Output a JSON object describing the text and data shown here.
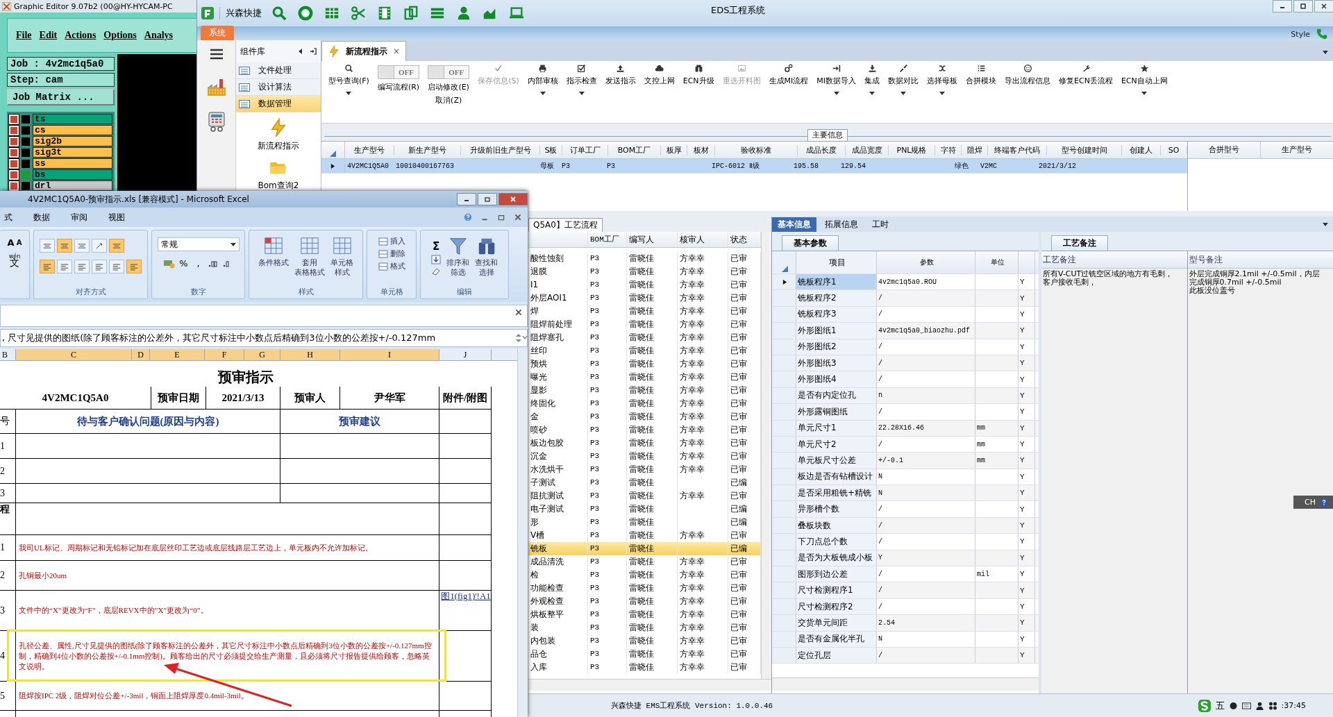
{
  "graphic_editor": {
    "title": "Graphic Editor 9.07b2 (00@HY-HYCAM-PC",
    "menu": [
      "File",
      "Edit",
      "Actions",
      "Options",
      "Analys"
    ],
    "job": "Job : 4v2mc1q5a0",
    "step": "Step: cam",
    "matrix_button": "Job Matrix ...",
    "layers": [
      {
        "name": "ts",
        "color": "#00a67a",
        "selected": false
      },
      {
        "name": "cs",
        "color": "#ffc04a",
        "selected": false
      },
      {
        "name": "sig2b",
        "color": "#ffc04a",
        "selected": false
      },
      {
        "name": "sig3t",
        "color": "#ffc04a",
        "selected": false
      },
      {
        "name": "ss",
        "color": "#ffc04a",
        "selected": false
      },
      {
        "name": "bs",
        "color": "#00a67a",
        "selected": true
      },
      {
        "name": "drl",
        "color": "#c8c8c8",
        "selected": false
      }
    ]
  },
  "eds": {
    "app_name": "兴森快捷",
    "title": "EDS工程系统",
    "style_label": "Style",
    "system_tab": "系统",
    "component_panel": {
      "title": "组件库",
      "items": [
        {
          "label": "文件处理",
          "selected": false
        },
        {
          "label": "设计算法",
          "selected": false
        },
        {
          "label": "数据管理",
          "selected": true
        }
      ],
      "tools": [
        "新流程指示",
        "Bom查询2"
      ]
    },
    "doc_tab": {
      "label": "新流程指示",
      "close": "×"
    },
    "ribbon": [
      {
        "kind": "button",
        "label": "型号查询(F)",
        "dropdown": true,
        "disabled": false
      },
      {
        "kind": "toggle",
        "switch": "OFF",
        "on": false,
        "label": "编写流程(R)"
      },
      {
        "kind": "toggle",
        "switch": "OFF",
        "on": false,
        "label": "启动修改(E)",
        "sublabel": "取消(Z)"
      },
      {
        "kind": "button",
        "label": "保存信息(S)",
        "dropdown": false,
        "disabled": true
      },
      {
        "kind": "button",
        "label": "内部审核",
        "dropdown": true,
        "disabled": false
      },
      {
        "kind": "button",
        "label": "指示检查",
        "dropdown": true,
        "disabled": false
      },
      {
        "kind": "button",
        "label": "发送指示",
        "dropdown": false,
        "disabled": false
      },
      {
        "kind": "button",
        "label": "文控上网",
        "dropdown": false,
        "disabled": false
      },
      {
        "kind": "button",
        "label": "ECN升级",
        "dropdown": false,
        "disabled": false
      },
      {
        "kind": "button",
        "label": "重选开料图",
        "dropdown": false,
        "disabled": true
      },
      {
        "kind": "button",
        "label": "生成MI流程",
        "dropdown": false,
        "disabled": false
      },
      {
        "kind": "button",
        "label": "MI数据导入",
        "dropdown": true,
        "disabled": false
      },
      {
        "kind": "button",
        "label": "集成",
        "dropdown": true,
        "disabled": false
      },
      {
        "kind": "button",
        "label": "数据对比",
        "dropdown": true,
        "disabled": false
      },
      {
        "kind": "button",
        "label": "选择母板",
        "dropdown": true,
        "disabled": false
      },
      {
        "kind": "button",
        "label": "合拼模块",
        "dropdown": false,
        "disabled": false
      },
      {
        "kind": "button",
        "label": "导出流程信息",
        "dropdown": false,
        "disabled": false
      },
      {
        "kind": "button",
        "label": "修复ECN丢流程",
        "dropdown": false,
        "disabled": false
      },
      {
        "kind": "button",
        "label": "ECN自动上网",
        "dropdown": true,
        "disabled": false
      }
    ],
    "section_label": "主要信息",
    "main_grid": {
      "columns": [
        "生产型号",
        "新生产型号",
        "升级前旧生产型号",
        "S板",
        "订单工厂",
        "BOM工厂",
        "板厚",
        "板材",
        "验收标准",
        "成品长度",
        "成品宽度",
        "PNL规格",
        "字符",
        "阻焊",
        "终端客户代码",
        "型号创建时间",
        "创建人",
        "SO"
      ],
      "rows": [
        {
          "selected": true,
          "cells": [
            "4V2MC1Q5A0",
            "10010400167763",
            null,
            "母板",
            "P3",
            "P3",
            null,
            null,
            "IPC-6012 Ⅱ级",
            "195.58",
            "129.54",
            null,
            null,
            "绿色",
            "V2MC",
            "2021/3/12",
            null,
            null
          ]
        }
      ]
    },
    "merge_grid": {
      "columns": [
        "合拼型号",
        "生产型号"
      ]
    },
    "process_table": {
      "tab": "Q5A0】工艺流程",
      "columns": [
        "BOM工厂",
        "编写人",
        "核审人",
        "状态"
      ],
      "rows": [
        {
          "step": "酸性蚀刻",
          "factory": "P3",
          "writer": "雷晓佳",
          "reviewer": "方幸幸",
          "status": "已审",
          "selected": false
        },
        {
          "step": "退膜",
          "factory": "P3",
          "writer": "雷晓佳",
          "reviewer": "方幸幸",
          "status": "已审",
          "selected": false
        },
        {
          "step": "I1",
          "factory": "P3",
          "writer": "雷晓佳",
          "reviewer": "方幸幸",
          "status": "已审",
          "selected": false
        },
        {
          "step": "外层AOI1",
          "factory": "P3",
          "writer": "雷晓佳",
          "reviewer": "方幸幸",
          "status": "已审",
          "selected": false
        },
        {
          "step": "焊",
          "factory": "P3",
          "writer": "雷晓佳",
          "reviewer": "方幸幸",
          "status": "已审",
          "selected": false
        },
        {
          "step": "阻焊前处理",
          "factory": "P3",
          "writer": "雷晓佳",
          "reviewer": "方幸幸",
          "status": "已审",
          "selected": false
        },
        {
          "step": "阻焊塞孔",
          "factory": "P3",
          "writer": "雷晓佳",
          "reviewer": "方幸幸",
          "status": "已审",
          "selected": false
        },
        {
          "step": "丝印",
          "factory": "P3",
          "writer": "雷晓佳",
          "reviewer": "方幸幸",
          "status": "已审",
          "selected": false
        },
        {
          "step": "预烘",
          "factory": "P3",
          "writer": "雷晓佳",
          "reviewer": "方幸幸",
          "status": "已审",
          "selected": false
        },
        {
          "step": "曝光",
          "factory": "P3",
          "writer": "雷晓佳",
          "reviewer": "方幸幸",
          "status": "已审",
          "selected": false
        },
        {
          "step": "显影",
          "factory": "P3",
          "writer": "雷晓佳",
          "reviewer": "方幸幸",
          "status": "已审",
          "selected": false
        },
        {
          "step": "终固化",
          "factory": "P3",
          "writer": "雷晓佳",
          "reviewer": "方幸幸",
          "status": "已审",
          "selected": false
        },
        {
          "step": "金",
          "factory": "P3",
          "writer": "雷晓佳",
          "reviewer": "方幸幸",
          "status": "已审",
          "selected": false
        },
        {
          "step": "喷砂",
          "factory": "P3",
          "writer": "雷晓佳",
          "reviewer": "方幸幸",
          "status": "已审",
          "selected": false
        },
        {
          "step": "板边包胶",
          "factory": "P3",
          "writer": "雷晓佳",
          "reviewer": "方幸幸",
          "status": "已审",
          "selected": false
        },
        {
          "step": "沉金",
          "factory": "P3",
          "writer": "雷晓佳",
          "reviewer": "方幸幸",
          "status": "已审",
          "selected": false
        },
        {
          "step": "水洗烘干",
          "factory": "P3",
          "writer": "雷晓佳",
          "reviewer": "方幸幸",
          "status": "已审",
          "selected": false
        },
        {
          "step": "子测试",
          "factory": "P3",
          "writer": "雷晓佳",
          "status": "已编",
          "selected": false
        },
        {
          "step": "阻抗测试",
          "factory": "P3",
          "writer": "雷晓佳",
          "reviewer": "方幸幸",
          "status": "已审",
          "selected": false
        },
        {
          "step": "电子测试",
          "factory": "P3",
          "writer": "雷晓佳",
          "status": "已编",
          "selected": false
        },
        {
          "step": "形",
          "factory": "P3",
          "writer": "雷晓佳",
          "status": "已编",
          "selected": false
        },
        {
          "step": "V槽",
          "factory": "P3",
          "writer": "雷晓佳",
          "reviewer": "方幸幸",
          "status": "已审",
          "selected": false
        },
        {
          "step": "铣板",
          "factory": "P3",
          "writer": "雷晓佳",
          "status": "已编",
          "selected": true
        },
        {
          "step": "成品清洗",
          "factory": "P3",
          "writer": "雷晓佳",
          "reviewer": "方幸幸",
          "status": "已审",
          "selected": false
        },
        {
          "step": "检",
          "factory": "P3",
          "writer": "雷晓佳",
          "reviewer": "方幸幸",
          "status": "已审",
          "selected": false
        },
        {
          "step": "功能检查",
          "factory": "P3",
          "writer": "雷晓佳",
          "reviewer": "方幸幸",
          "status": "已审",
          "selected": false
        },
        {
          "step": "外观检查",
          "factory": "P3",
          "writer": "雷晓佳",
          "reviewer": "方幸幸",
          "status": "已审",
          "selected": false
        },
        {
          "step": "烘板整平",
          "factory": "P3",
          "writer": "雷晓佳",
          "reviewer": "方幸幸",
          "status": "已审",
          "selected": false
        },
        {
          "step": "装",
          "factory": "P3",
          "writer": "雷晓佳",
          "reviewer": "方幸幸",
          "status": "已审",
          "selected": false
        },
        {
          "step": "内包装",
          "factory": "P3",
          "writer": "雷晓佳",
          "reviewer": "方幸幸",
          "status": "已审",
          "selected": false
        },
        {
          "step": "品仓",
          "factory": "P3",
          "writer": "雷晓佳",
          "reviewer": "方幸幸",
          "status": "已审",
          "selected": false
        },
        {
          "step": "入库",
          "factory": "P3",
          "writer": "雷晓佳",
          "reviewer": "方幸幸",
          "status": "已审",
          "selected": false
        }
      ]
    },
    "detail_panel": {
      "tabs": [
        {
          "label": "基本信息",
          "selected": true
        },
        {
          "label": "拓展信息",
          "selected": false
        },
        {
          "label": "工时",
          "selected": false
        }
      ],
      "params_tab": "基本参数",
      "columns": [
        "项目",
        "参数",
        "单位"
      ],
      "rows": [
        {
          "item": "铣板程序1",
          "value": "4v2mc1q5a0.ROU",
          "flag": "Y",
          "selected": true
        },
        {
          "item": "铣板程序2",
          "value": "/",
          "flag": "Y",
          "selected": false
        },
        {
          "item": "铣板程序3",
          "value": "/",
          "flag": "Y",
          "selected": false
        },
        {
          "item": "外形图纸1",
          "value": "4v2mc1q5a0_biaozhu.pdf",
          "flag": "Y",
          "selected": false
        },
        {
          "item": "外形图纸2",
          "value": "/",
          "flag": "Y",
          "selected": false
        },
        {
          "item": "外形图纸3",
          "value": "/",
          "flag": "Y",
          "selected": false
        },
        {
          "item": "外形图纸4",
          "value": "/",
          "flag": "Y",
          "selected": false
        },
        {
          "item": "是否有内定位孔",
          "value": "n",
          "flag": "Y",
          "selected": false
        },
        {
          "item": "外形露铜图纸",
          "value": "/",
          "flag": "Y",
          "selected": false
        },
        {
          "item": "单元尺寸1",
          "value": "22.28X16.46",
          "unit": "mm",
          "flag": "Y",
          "selected": false
        },
        {
          "item": "单元尺寸2",
          "value": "/",
          "unit": "mm",
          "flag": "Y",
          "selected": false
        },
        {
          "item": "单元板尺寸公差",
          "value": "+/-0.1",
          "unit": "mm",
          "flag": "Y",
          "selected": false
        },
        {
          "item": "板边是否有钻槽设计",
          "value": "N",
          "flag": "Y",
          "selected": false
        },
        {
          "item": "是否采用粗铣+精铣",
          "value": "N",
          "flag": "Y",
          "selected": false
        },
        {
          "item": "异形槽个数",
          "value": "/",
          "flag": "Y",
          "selected": false
        },
        {
          "item": "叠板块数",
          "value": "/",
          "flag": "Y",
          "selected": false
        },
        {
          "item": "下刀点总个数",
          "value": "/",
          "flag": "Y",
          "selected": false
        },
        {
          "item": "是否为大板铣成小板",
          "value": "Y",
          "flag": "Y",
          "selected": false
        },
        {
          "item": "图形到边公差",
          "value": "/",
          "unit": "mil",
          "flag": "Y",
          "selected": false
        },
        {
          "item": "尺寸检测程序1",
          "value": "/",
          "flag": "Y",
          "selected": false
        },
        {
          "item": "尺寸检测程序2",
          "value": "/",
          "flag": "Y",
          "selected": false
        },
        {
          "item": "交货单元间距",
          "value": "2.54",
          "flag": "Y",
          "selected": false
        },
        {
          "item": "是否有金属化半孔",
          "value": "N",
          "flag": "Y",
          "selected": false
        },
        {
          "item": "定位孔层",
          "value": "/",
          "flag": "Y",
          "selected": false
        }
      ],
      "notes_tab": "工艺备注",
      "notes": [
        {
          "header": "工艺备注",
          "text": "所有V-CUT过铣空区域的地方有毛刺，客户接收毛刺，"
        },
        {
          "header": "型号备注",
          "text": "外层完成铜厚2.1mil +/-0.5mil，内层完成铜厚0.7mil +/-0.5mil\n此板没位盖号"
        }
      ]
    },
    "status_bar": {
      "text": "兴森快捷 EMS工程系统 Version: 1.0.0.46",
      "time": ":37:45"
    },
    "ime": {
      "lang": "CH",
      "mode": "五"
    }
  },
  "excel": {
    "title": "4V2MC1Q5A0-预审指示.xls  [兼容模式] - Microsoft Excel",
    "tabs": [
      "式",
      "数据",
      "审阅",
      "视图"
    ],
    "font_buttons": [
      "A",
      "A"
    ],
    "phonetic": {
      "top": "wén",
      "glyph": "文"
    },
    "align_buttons": [
      {
        "selected": false
      },
      {
        "selected": true
      },
      {
        "selected": false
      },
      {
        "selected": false
      },
      {
        "selected": true
      },
      {
        "selected": true
      },
      {
        "selected": false
      },
      {
        "selected": false
      },
      {
        "selected": false
      },
      {
        "selected": false
      },
      {
        "selected": true
      }
    ],
    "groups": {
      "alignment": "对齐方式",
      "number": "数字",
      "styles": "样式",
      "cells": "单元格",
      "editing": "编辑"
    },
    "number_format": "常规",
    "number_symbols": [
      "%",
      ","
    ],
    "style_buttons": [
      [
        "条件格式"
      ],
      [
        "套用",
        "表格格式"
      ],
      [
        "单元格",
        "样式"
      ]
    ],
    "cell_buttons": [
      "插入",
      "删除",
      "格式"
    ],
    "sum": "Σ",
    "edit_buttons": [
      [
        "排序和",
        "筛选"
      ],
      [
        "查找和",
        "选择"
      ]
    ],
    "formula_text": ", 尺寸见提供的图纸(除了顾客标注的公差外，其它尺寸标注中小数点后精确到3位小数的公差按+/-0.127mm",
    "columns": [
      {
        "label": "B",
        "selected": false
      },
      {
        "label": "C",
        "selected": true
      },
      {
        "label": "D",
        "selected": true
      },
      {
        "label": "E",
        "selected": true
      },
      {
        "label": "F",
        "selected": true
      },
      {
        "label": "G",
        "selected": true
      },
      {
        "label": "H",
        "selected": true
      },
      {
        "label": "I",
        "selected": true
      },
      {
        "label": "J",
        "selected": false
      }
    ],
    "sheet": {
      "title": "预审指示",
      "header": [
        "4V2MC1Q5A0",
        "预审日期",
        "2021/3/13",
        "预审人",
        "尹华军",
        "附件/附图"
      ],
      "subheader": [
        "号",
        "待与客户确认问题(原因与内容)",
        "预审建议"
      ],
      "question_rows": [
        "1",
        "2",
        "3"
      ],
      "section": "程",
      "instructions": [
        {
          "no": "1",
          "text": "我司UL标记、周期标记和无铅标记加在底层丝印工艺边或底层线路层工艺边上，单元板内不允许加标记。",
          "highlighted": false
        },
        {
          "no": "2",
          "text": "孔铜最小20um",
          "highlighted": false
        },
        {
          "no": "3",
          "text": "文件中的“X”更改为“F”，底层REVX中的”X”更改为“0”。",
          "attachment": "图1(fig1)'!A1",
          "highlighted": false
        },
        {
          "no": "4",
          "text": "孔径公差、属性,尺寸见提供的图纸(除了顾客标注的公差外，其它尺寸标注中小数点后精确到3位小数的公差按+/-0.127mm控制，精确到4位小数的公差按+/-0.1mm控制)。顾客给出的尺寸必须提交给生产测量，且必须将尺寸报告提供给顾客，忽略英文说明。",
          "highlighted": true
        },
        {
          "no": "5",
          "text": "阻焊按IPC 2级，阻焊对位公差+/-3mil，铜面上阻焊厚度0.4mil-3mil。",
          "highlighted": false
        }
      ]
    }
  }
}
